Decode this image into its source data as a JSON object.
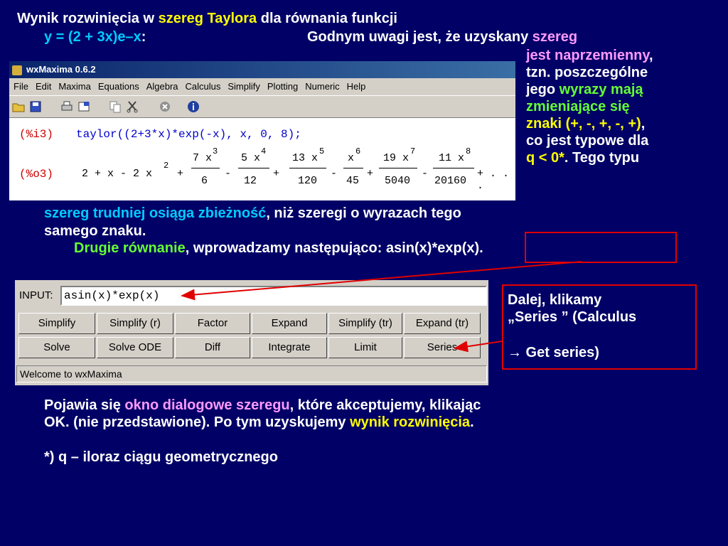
{
  "heading": {
    "line1_a": "Wynik rozwinięcia w ",
    "line1_b": "szereg Taylora",
    "line1_c": " dla równania funkcji",
    "line2_func": "y = (2 + 3x)e–x",
    "line2_colon": ":",
    "line2_note": "Godnym uwagi jest, że uzyskany ",
    "line2_szereg": "szereg"
  },
  "side_note": {
    "l1_a": "jest naprzemienny",
    "l1_b": ",",
    "l2": "tzn. poszczególne",
    "l3_a": "jego ",
    "l3_b": "wyrazy mają",
    "l4": "zmieniające się",
    "l5_a": "znaki (+, -, +, -, +)",
    "l5_b": ",",
    "l6": "co jest typowe dla",
    "l7_a": "q < 0*",
    "l7_b": ". Tego typu"
  },
  "window": {
    "title": "wxMaxima 0.6.2",
    "menu": [
      "File",
      "Edit",
      "Maxima",
      "Equations",
      "Algebra",
      "Calculus",
      "Simplify",
      "Plotting",
      "Numeric",
      "Help"
    ],
    "input_label": "(%i3)",
    "input_cmd": "taylor((2+3*x)*exp(-x), x, 0, 8);",
    "output_label": "(%o3)",
    "output": {
      "t0": "2 + x - 2 x",
      "t0_exp": "2",
      "f1_num": "7 x",
      "f1_exp": "3",
      "f1_den": "6",
      "f2_num": "5 x",
      "f2_exp": "4",
      "f2_den": "12",
      "f3_num": "13 x",
      "f3_exp": "5",
      "f3_den": "120",
      "f4_num": "x",
      "f4_exp": "6",
      "f4_den": "45",
      "f5_num": "19 x",
      "f5_exp": "7",
      "f5_den": "5040",
      "f6_num": "11 x",
      "f6_exp": "8",
      "f6_den": "20160",
      "ops": [
        "+",
        "-",
        "+",
        "-",
        "+",
        "-",
        "+ . . ."
      ]
    }
  },
  "middle": {
    "l1_a": "szereg trudniej osiąga zbieżność",
    "l1_b": ", niż szeregi o  wyrazach tego",
    "l2": "samego znaku.",
    "l3_a": "Drugie równanie",
    "l3_b": ", wprowadzamy następująco: ",
    "l3_expr": "asin(x)*exp(x)",
    "l3_end": "."
  },
  "panel": {
    "input_label": "INPUT:",
    "input_value": "asin(x)*exp(x)",
    "row1": [
      "Simplify",
      "Simplify (r)",
      "Factor",
      "Expand",
      "Simplify (tr)",
      "Expand (tr)"
    ],
    "row2": [
      "Solve",
      "Solve ODE",
      "Diff",
      "Integrate",
      "Limit",
      "Series"
    ],
    "status": "Welcome to wxMaxima"
  },
  "series_note": {
    "l1": "Dalej, klikamy",
    "l2": "„Series ” (Calculus",
    "l3_arrow": "→",
    "l3_text": " Get series)"
  },
  "bottom": {
    "l1_a": "Pojawia się ",
    "l1_b": "okno dialogowe szeregu",
    "l1_c": ", które akceptujemy, klikając",
    "l2_a": "OK. (nie przedstawione). Po tym uzyskujemy ",
    "l2_b": "wynik rozwinięcia",
    "l2_c": ".",
    "footnote": "*) q – iloraz ciągu geometrycznego"
  },
  "colors": {
    "background": "#000066",
    "cyan": "#00ccff",
    "pink": "#ff99ff",
    "yellow": "#ffff00",
    "green": "#66ff33",
    "red": "#e00000"
  }
}
